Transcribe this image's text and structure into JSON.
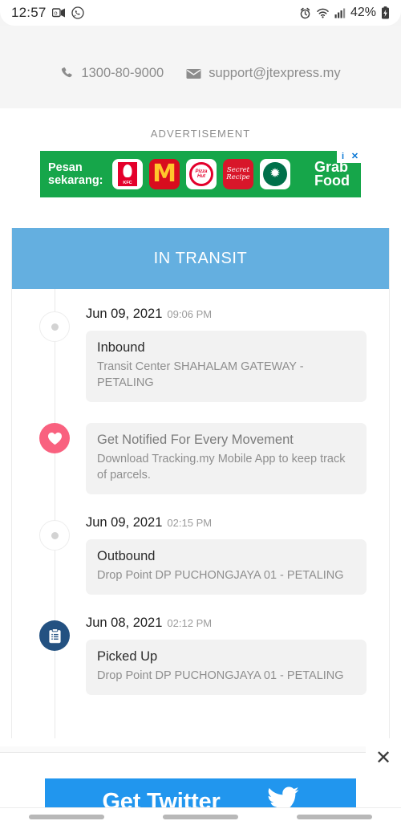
{
  "status_bar": {
    "time": "12:57",
    "battery": "42%",
    "left_icons": [
      "outlook-icon",
      "whatsapp-icon"
    ],
    "right_icons": [
      "alarm-icon",
      "wifi-icon",
      "signal-icon",
      "battery-charging-icon"
    ]
  },
  "contact": {
    "phone": "1300-80-9000",
    "email": "support@jtexpress.my"
  },
  "advertisement": {
    "label": "ADVERTISEMENT",
    "cta": "Pesan sekarang:",
    "brand": "Grab Food",
    "brand_line1": "Grab",
    "brand_line2": "Food",
    "logos": [
      "KFC",
      "M",
      "Pizza Hut",
      "Secret Recipe",
      "Starbucks"
    ],
    "kfc_label": "KFC",
    "mcd_label": "M",
    "pizzahut_label": "Pizza Hut",
    "secret_line1": "Secret",
    "secret_line2": "Recipe",
    "starbucks_glyph": "✹",
    "info_badge": "i",
    "close_badge": "✕"
  },
  "tracking": {
    "status_header": "IN TRANSIT",
    "events": [
      {
        "date": "Jun 09, 2021",
        "time": "09:06 PM",
        "title": "Inbound",
        "location": "Transit Center SHAHALAM GATEWAY - PETALING",
        "marker": "dot"
      },
      {
        "date": "",
        "time": "",
        "title": "Get Notified For Every Movement",
        "location": "Download Tracking.my Mobile App to keep track of parcels.",
        "marker": "heart"
      },
      {
        "date": "Jun 09, 2021",
        "time": "02:15 PM",
        "title": "Outbound",
        "location": "Drop Point DP PUCHONGJAYA 01 - PETALING",
        "marker": "dot"
      },
      {
        "date": "Jun 08, 2021",
        "time": "02:12 PM",
        "title": "Picked Up",
        "location": "Drop Point DP PUCHONGJAYA 01 - PETALING",
        "marker": "clipboard"
      }
    ]
  },
  "bottom_ad": {
    "label": "Get Twitter",
    "close_label": "✕",
    "icon": "twitter-bird-icon"
  },
  "colors": {
    "header_blue": "#64afe0",
    "heart_pink": "#f9617f",
    "clipboard_navy": "#235181",
    "twitter_blue": "#2196ee",
    "grab_green": "#16a64a",
    "box_gray": "#f2f2f2"
  }
}
